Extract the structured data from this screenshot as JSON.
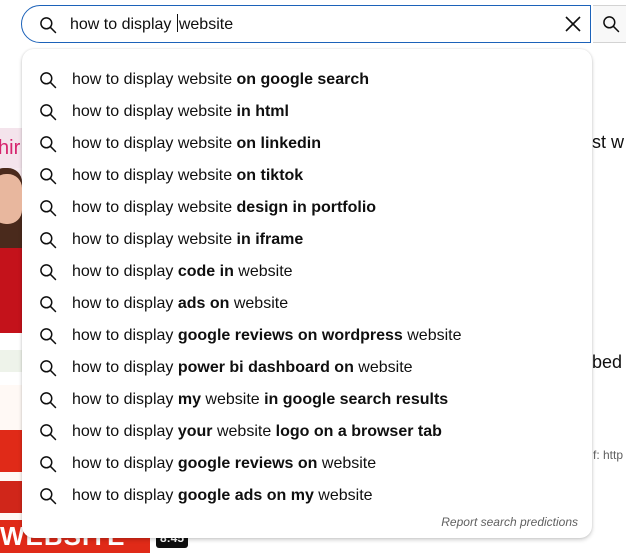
{
  "search": {
    "query_before_caret": "how to display ",
    "query_after_caret": "website"
  },
  "icons": {
    "search": "search-icon",
    "clear": "close-icon"
  },
  "suggestions": [
    {
      "prefix": "how to display website ",
      "bold": "on google search",
      "suffix": ""
    },
    {
      "prefix": "how to display website ",
      "bold": "in html",
      "suffix": ""
    },
    {
      "prefix": "how to display website ",
      "bold": "on linkedin",
      "suffix": ""
    },
    {
      "prefix": "how to display website ",
      "bold": "on tiktok",
      "suffix": ""
    },
    {
      "prefix": "how to display website ",
      "bold": "design in portfolio",
      "suffix": ""
    },
    {
      "prefix": "how to display website ",
      "bold": "in iframe",
      "suffix": ""
    },
    {
      "prefix": "how to display ",
      "bold": "code in",
      "suffix": " website"
    },
    {
      "prefix": "how to display ",
      "bold": "ads on",
      "suffix": " website"
    },
    {
      "prefix": "how to display ",
      "bold": "google reviews on wordpress",
      "suffix": " website"
    },
    {
      "prefix": "how to display ",
      "bold": "power bi dashboard on",
      "suffix": " website"
    },
    {
      "prefix": "how to display ",
      "bold": "my",
      "suffix": " website ",
      "bold2": "in google search results"
    },
    {
      "prefix": "how to display ",
      "bold": "your",
      "suffix": " website ",
      "bold2": "logo on a browser tab"
    },
    {
      "prefix": "how to display ",
      "bold": "google reviews on",
      "suffix": " website"
    },
    {
      "prefix": "how to display ",
      "bold": "google ads on my",
      "suffix": " website"
    }
  ],
  "report_label": "Report search predictions",
  "background": {
    "snippet_1": "st w",
    "snippet_2": "bed",
    "snippet_3": "f: http",
    "thumb_top_text": "hir",
    "thumb_bottom_text": "WEBSITE",
    "duration": "8:45"
  },
  "colors": {
    "focus_border": "#1c62b9",
    "text": "#0f0f0f",
    "muted": "#606060"
  }
}
